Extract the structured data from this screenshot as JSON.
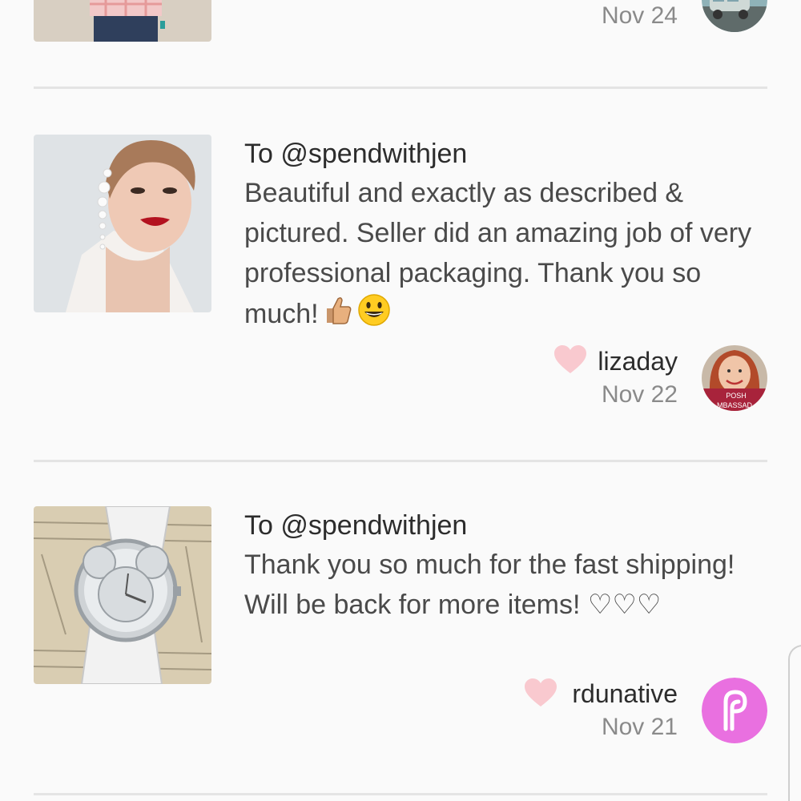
{
  "reviews": [
    {
      "date": "Nov 24"
    },
    {
      "to": "To @spendwithjen",
      "comment": "Beautiful and exactly as described & pictured. Seller did an amazing job of very professional packaging. Thank you so much!",
      "emojis": [
        "thumbs-up-icon",
        "grinning-face-icon"
      ],
      "username": "lizaday",
      "date": "Nov 22",
      "avatar_badge": "POSH AMBASSADOR",
      "avatar_badge_visible": "POSH\nMBASSAD"
    },
    {
      "to": "To @spendwithjen",
      "comment": "Thank you so much for the fast shipping! Will be back for more items! ♡♡♡",
      "username": "rdunative",
      "date": "Nov 21"
    }
  ],
  "colors": {
    "background": "#fafafa",
    "divider": "#e4e4e4",
    "heart": "#f9c9cf",
    "brand_pink": "#e970e0",
    "badge_red": "#a8233b"
  }
}
